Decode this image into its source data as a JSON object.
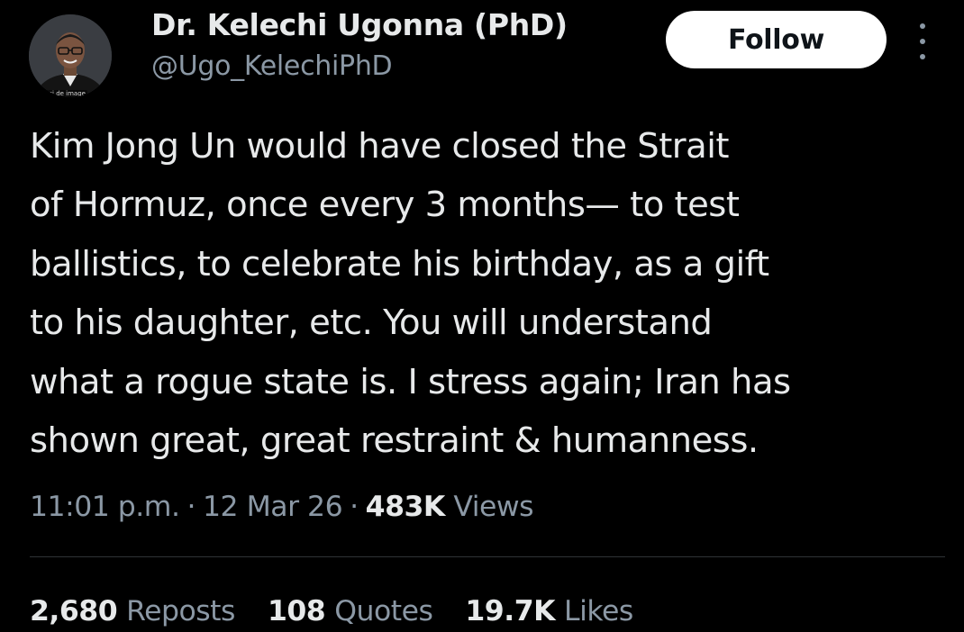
{
  "author": {
    "display_name": "Dr. Kelechi Ugonna (PhD)",
    "handle": "@Ugo_KelechiPhD",
    "avatar_caption": "insi de image"
  },
  "follow_button_label": "Follow",
  "more_menu_icon": "vertical-ellipsis-icon",
  "tweet": {
    "lines": [
      "Kim Jong Un would have closed the Strait",
      "of Hormuz, once every 3 months— to test",
      "ballistics, to celebrate his birthday, as a gift",
      "to his daughter, etc. You will understand",
      "what a rogue state is. I stress again; Iran has",
      "shown great, great restraint & humanness."
    ]
  },
  "meta": {
    "time": "11:01 p.m.",
    "separator": "·",
    "date": "12 Mar 26",
    "views_count": "483K",
    "views_label": "Views"
  },
  "stats": {
    "reposts_count": "2,680",
    "reposts_label": "Reposts",
    "quotes_count": "108",
    "quotes_label": "Quotes",
    "likes_count": "19.7K",
    "likes_label": "Likes"
  },
  "colors": {
    "background": "#000000",
    "primary_text": "#e7e9ea",
    "secondary_text": "#8b98a5",
    "follow_bg": "#ffffff",
    "divider": "#2f3336"
  }
}
